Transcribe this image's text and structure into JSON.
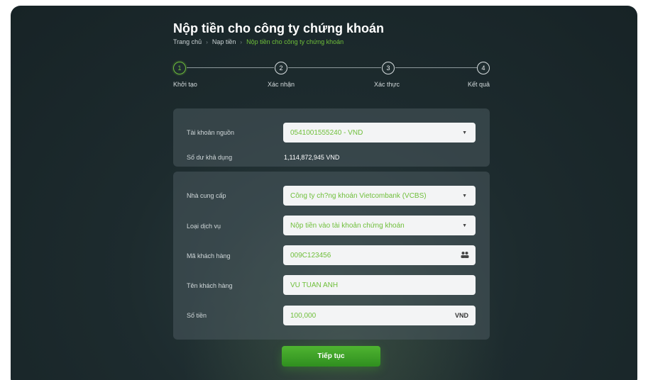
{
  "page": {
    "title": "Nộp tiền cho công ty chứng khoán",
    "breadcrumb": [
      "Trang chủ",
      "Nạp tiền",
      "Nộp tiền cho công ty chứng khoán"
    ]
  },
  "steps": [
    {
      "number": "1",
      "label": "Khởi tạo",
      "active": true
    },
    {
      "number": "2",
      "label": "Xác nhận",
      "active": false
    },
    {
      "number": "3",
      "label": "Xác thực",
      "active": false
    },
    {
      "number": "4",
      "label": "Kết quả",
      "active": false
    }
  ],
  "source": {
    "account_label": "Tài khoản nguồn",
    "account_value": "0541001555240 - VND",
    "balance_label": "Số dư khả dụng",
    "balance_value": "1,114,872,945 VND"
  },
  "form": {
    "provider_label": "Nhà cung cấp",
    "provider_value": "Công ty ch?ng khoán Vietcombank (VCBS)",
    "service_label": "Loại dịch vụ",
    "service_value": "Nộp tiền vào tài khoản chứng khoán",
    "customer_code_label": "Mã khách hàng",
    "customer_code_value": "009C123456",
    "customer_name_label": "Tên khách hàng",
    "customer_name_value": "VU TUAN ANH",
    "amount_label": "Số tiền",
    "amount_value": "100,000",
    "currency": "VND"
  },
  "actions": {
    "continue_label": "Tiếp tục"
  },
  "colors": {
    "accent": "#6fbf3a",
    "button": "#3aa626",
    "background": "#1d2b2e"
  }
}
